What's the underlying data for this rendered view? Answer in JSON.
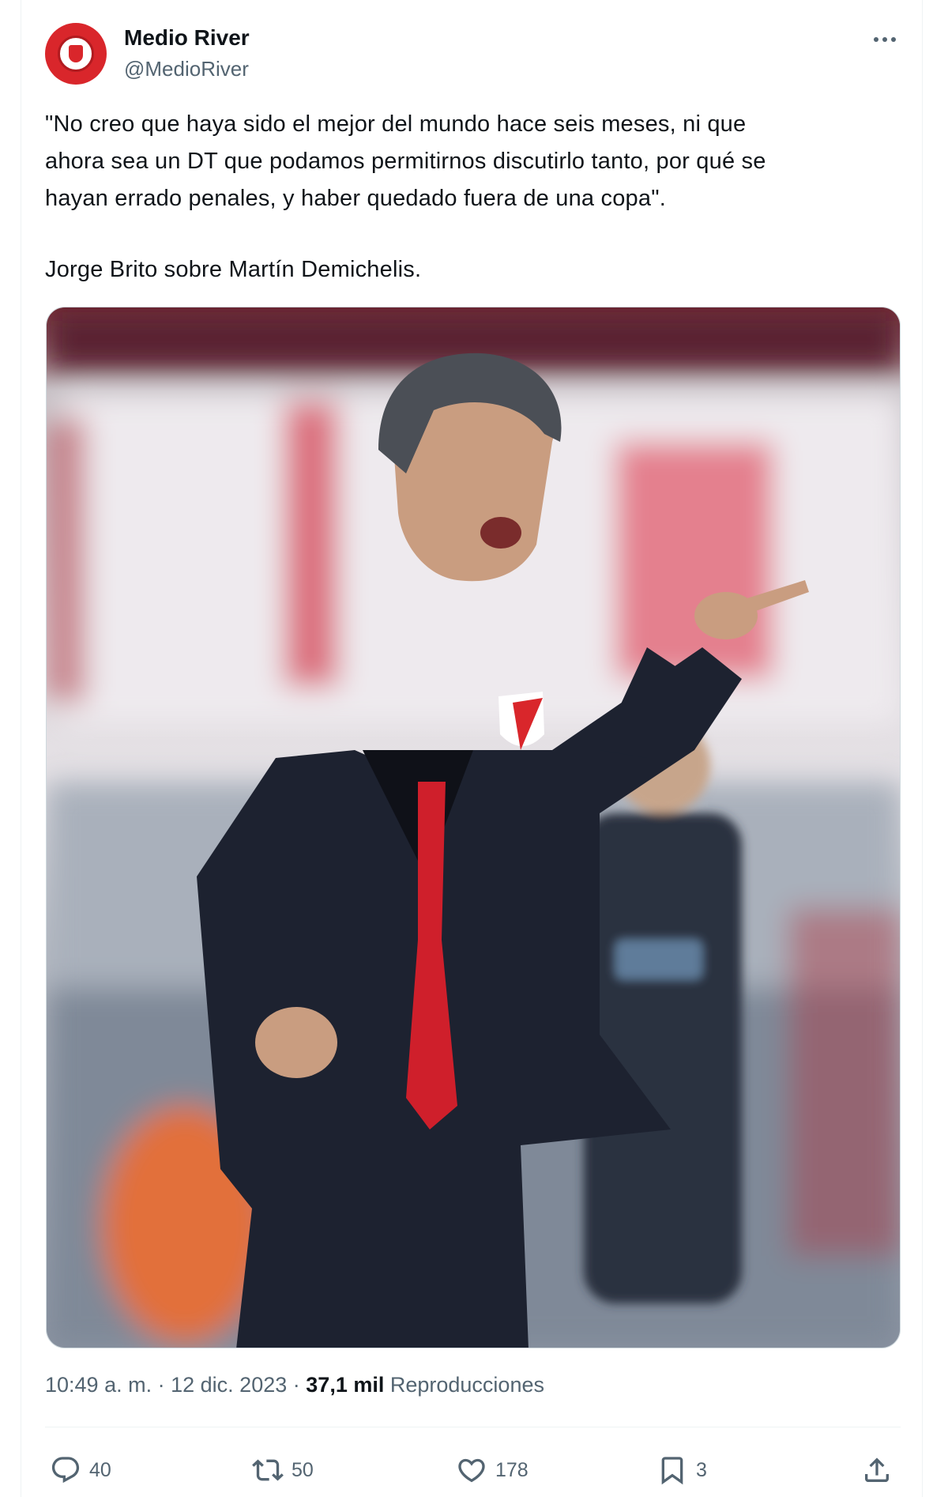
{
  "author": {
    "display_name": "Medio River",
    "handle": "@MedioRiver"
  },
  "tweet": {
    "text_lines": [
      "\"No creo que haya sido el mejor del mundo hace seis meses, ni que",
      "ahora sea un DT que podamos permitirnos discutirlo tanto, por qué se",
      "hayan errado penales, y haber quedado fuera de una copa\".",
      "Jorge Brito sobre Martín Demichelis."
    ]
  },
  "meta": {
    "time": "10:49 a. m.",
    "separator": "·",
    "date": "12 dic. 2023",
    "views_count": "37,1 mil",
    "views_label": "Reproducciones"
  },
  "actions": {
    "replies": "40",
    "retweets": "50",
    "likes": "178",
    "bookmarks": "3"
  },
  "icons": [
    "more-icon",
    "reply-icon",
    "retweet-icon",
    "like-icon",
    "bookmark-icon",
    "share-icon"
  ],
  "colors": {
    "text_primary": "#0f1419",
    "text_secondary": "#536471",
    "brand_red": "#d9262b"
  }
}
